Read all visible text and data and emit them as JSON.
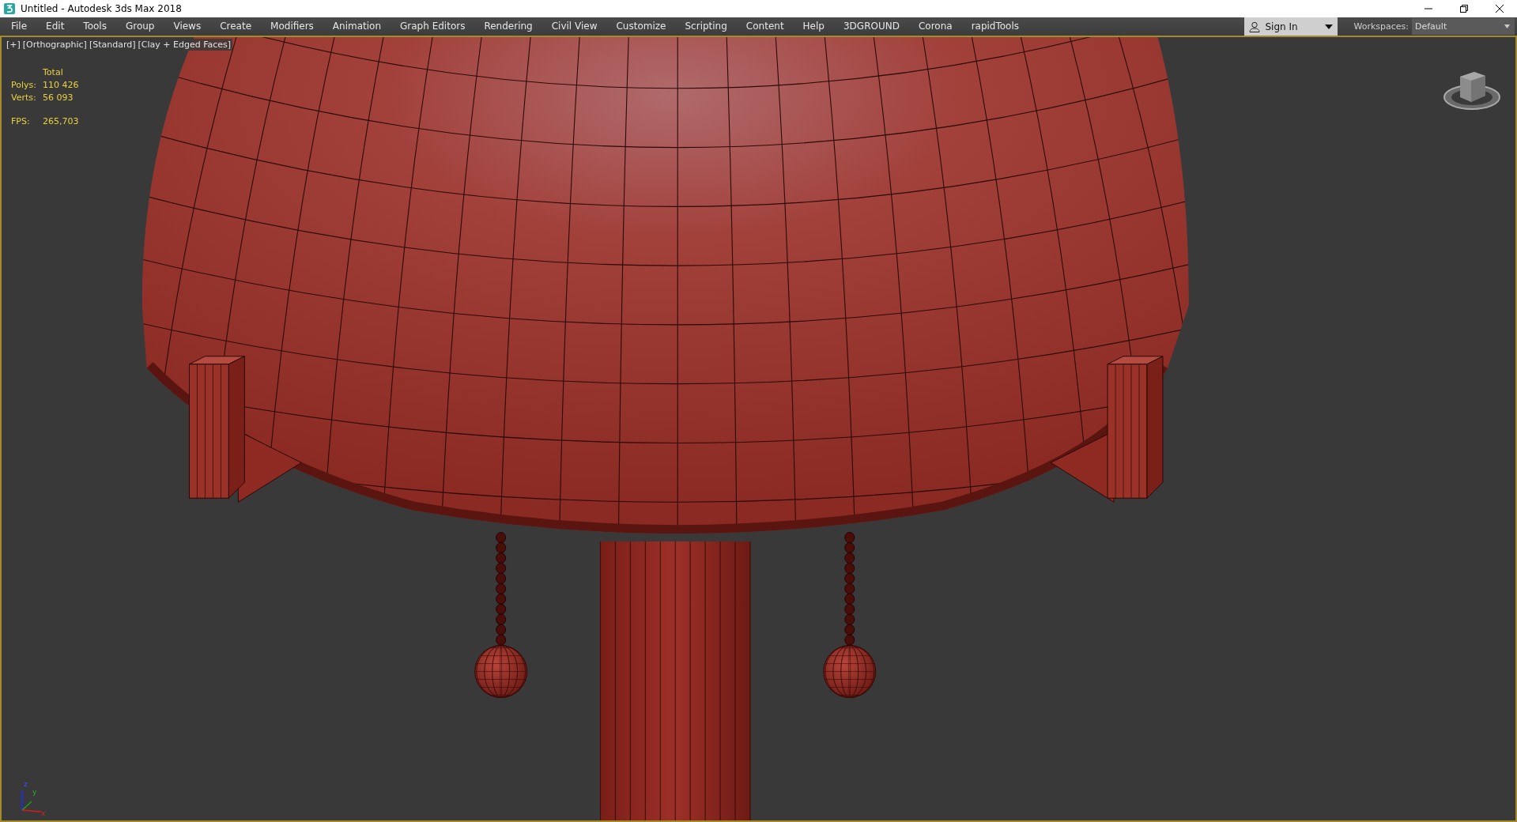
{
  "window": {
    "title": "Untitled - Autodesk 3ds Max 2018"
  },
  "menu": [
    {
      "label": "File"
    },
    {
      "label": "Edit"
    },
    {
      "label": "Tools"
    },
    {
      "label": "Group"
    },
    {
      "label": "Views"
    },
    {
      "label": "Create"
    },
    {
      "label": "Modifiers"
    },
    {
      "label": "Animation"
    },
    {
      "label": "Graph Editors"
    },
    {
      "label": "Rendering"
    },
    {
      "label": "Civil View"
    },
    {
      "label": "Customize"
    },
    {
      "label": "Scripting"
    },
    {
      "label": "Content"
    },
    {
      "label": "Help"
    },
    {
      "label": "3DGROUND"
    },
    {
      "label": "Corona"
    },
    {
      "label": "rapidTools"
    }
  ],
  "sign_in": {
    "label": "Sign In"
  },
  "workspaces": {
    "label": "Workspaces:",
    "value": "Default"
  },
  "viewport": {
    "active": true,
    "labels": [
      "[+]",
      "[Orthographic]",
      "[Standard]",
      "[Clay + Edged Faces]"
    ],
    "stats": {
      "header": "Total",
      "rows": [
        {
          "label": "Polys:",
          "value": "110 426"
        },
        {
          "label": "Verts:",
          "value": "56 093"
        }
      ],
      "fps": {
        "label": "FPS:",
        "value": "265,703"
      }
    },
    "axes": {
      "x": "x",
      "y": "y",
      "z": "z"
    }
  }
}
